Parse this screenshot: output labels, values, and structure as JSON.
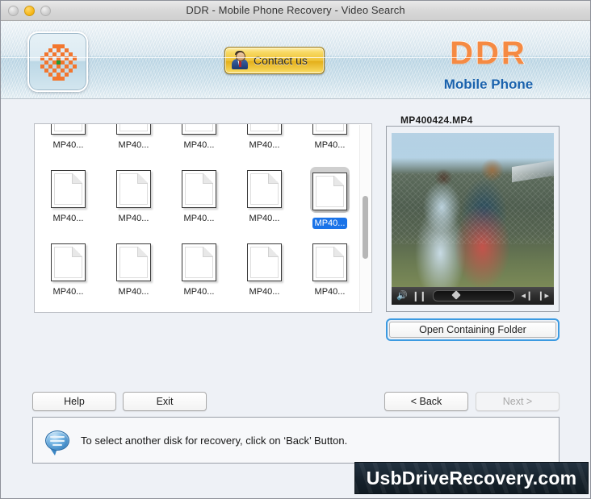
{
  "window": {
    "title": "DDR - Mobile Phone Recovery - Video Search",
    "traffic_lights": [
      "close",
      "minimize",
      "zoom"
    ]
  },
  "header": {
    "app_icon_name": "ddr-flower-icon",
    "contact_button": "Contact us",
    "brand_primary": "DDR",
    "brand_secondary": "Mobile Phone",
    "brand_primary_color": "#f58a43",
    "brand_secondary_color": "#1a62ad"
  },
  "filelist": {
    "rows": [
      [
        {
          "label": "MP40...",
          "selected": false
        },
        {
          "label": "MP40...",
          "selected": false
        },
        {
          "label": "MP40...",
          "selected": false
        },
        {
          "label": "MP40...",
          "selected": false
        },
        {
          "label": "MP40...",
          "selected": false
        }
      ],
      [
        {
          "label": "MP40...",
          "selected": false
        },
        {
          "label": "MP40...",
          "selected": false
        },
        {
          "label": "MP40...",
          "selected": false
        },
        {
          "label": "MP40...",
          "selected": false
        },
        {
          "label": "MP40...",
          "selected": true
        }
      ],
      [
        {
          "label": "MP40...",
          "selected": false
        },
        {
          "label": "MP40...",
          "selected": false
        },
        {
          "label": "MP40...",
          "selected": false
        },
        {
          "label": "MP40...",
          "selected": false
        },
        {
          "label": "MP40...",
          "selected": false
        }
      ],
      [
        {
          "label": "",
          "selected": false
        },
        {
          "label": "",
          "selected": false
        },
        {
          "label": "",
          "selected": false
        },
        {
          "label": "",
          "selected": false
        },
        {
          "label": "",
          "selected": false
        }
      ]
    ],
    "selection_color": "#1a73e8"
  },
  "preview": {
    "title": "MP400424.MP4",
    "controls": {
      "volume": "volume-icon",
      "pause": "pause-icon",
      "step_back": "step-back-icon",
      "step_forward": "step-forward-icon"
    },
    "open_folder_button": "Open Containing Folder"
  },
  "footer": {
    "help": "Help",
    "exit": "Exit",
    "back": "< Back",
    "next": "Next >",
    "next_disabled": true
  },
  "info": {
    "icon": "speech-bubble-icon",
    "message": "To select another disk for recovery, click on ‘Back’ Button."
  },
  "watermark": {
    "text": "UsbDriveRecovery.com"
  }
}
